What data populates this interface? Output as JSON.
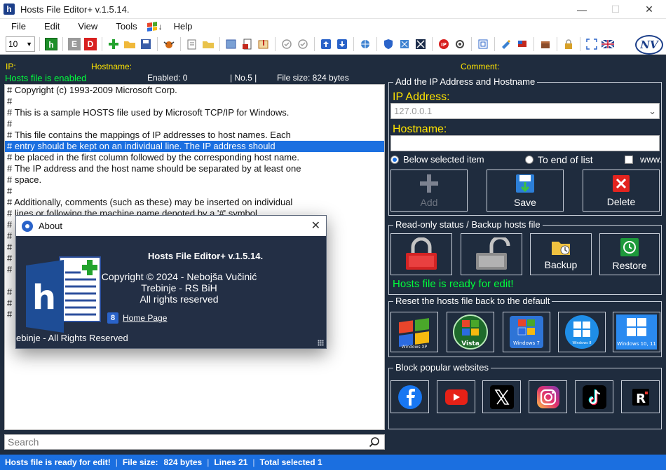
{
  "window": {
    "title": "Hosts File Editor+ v.1.5.14.",
    "app_icon_letter": "h"
  },
  "menu": [
    "File",
    "Edit",
    "View",
    "Tools",
    "Help"
  ],
  "menu_extra_arrow": "↓",
  "toolbar": {
    "zoom_value": "10",
    "btn_h": "h",
    "btn_e": "E",
    "btn_d": "D"
  },
  "logo_text": "NV",
  "columns": {
    "ip": "IP:",
    "hostname": "Hostname:",
    "comment": "Comment:"
  },
  "file_status": {
    "enabled_status": "Hosts file is enabled",
    "enabled_count": "Enabled: 0",
    "entry_no": "| No.5 |",
    "file_size": "File size: 824 bytes"
  },
  "editor_lines": [
    "# Copyright (c) 1993-2009 Microsoft Corp.",
    "#",
    "# This is a sample HOSTS file used by Microsoft TCP/IP for Windows.",
    "#",
    "# This file contains the mappings of IP addresses to host names. Each",
    "# entry should be kept on an individual line. The IP address should",
    "# be placed in the first column followed by the corresponding host name.",
    "# The IP address and the host name should be separated by at least one",
    "# space.",
    "#",
    "# Additionally, comments (such as these) may be inserted on individual",
    "# lines or following the machine name denoted by a '#' symbol.",
    "#",
    "#",
    "#",
    "#",
    "#",
    "",
    "#",
    "#",
    "#"
  ],
  "selected_line_index": 5,
  "search": {
    "placeholder": "Search"
  },
  "add_group": {
    "title": "Add the IP Address  and Hostname",
    "ip_label": "IP Address:",
    "ip_value": "127.0.0.1",
    "hostname_label": "Hostname:",
    "radio_below": "Below selected item",
    "radio_end": "To end of list",
    "check_www": "www.",
    "btn_add": "Add",
    "btn_save": "Save",
    "btn_delete": "Delete"
  },
  "readonly_group": {
    "title": "Read-only status / Backup hosts file",
    "btn_backup": "Backup",
    "btn_restore": "Restore",
    "ready_text": "Hosts file is ready for edit!"
  },
  "reset_group": {
    "title": "Reset the hosts file back to the default",
    "os_labels": [
      "Windows XP",
      "Vista",
      "Windows 7",
      "Windows 8",
      "Windows 10, 11"
    ]
  },
  "block_group": {
    "title": "Block popular websites",
    "sites": [
      "facebook",
      "youtube",
      "x",
      "instagram",
      "tiktok",
      "rumble"
    ]
  },
  "statusbar": {
    "ready": "Hosts file is ready for edit!",
    "file_size_label": "File size:",
    "file_size_value": "824 bytes",
    "lines": "Lines 21",
    "total_selected": "Total selected 1"
  },
  "about": {
    "title": "About",
    "app_name": "Hosts File Editor+ v.1.5.14.",
    "copyright": "Copyright © 2024 - Nebojša Vučinić",
    "location": "Trebinje - RS BiH",
    "rights": "All rights reserved",
    "home_page": "Home Page",
    "footer": "ebinje - All Rights Reserved"
  },
  "colors": {
    "background": "#1f2c3e",
    "accent_blue": "#1b6fe0",
    "label_yellow": "#ffe400",
    "status_green": "#00ff3c"
  }
}
